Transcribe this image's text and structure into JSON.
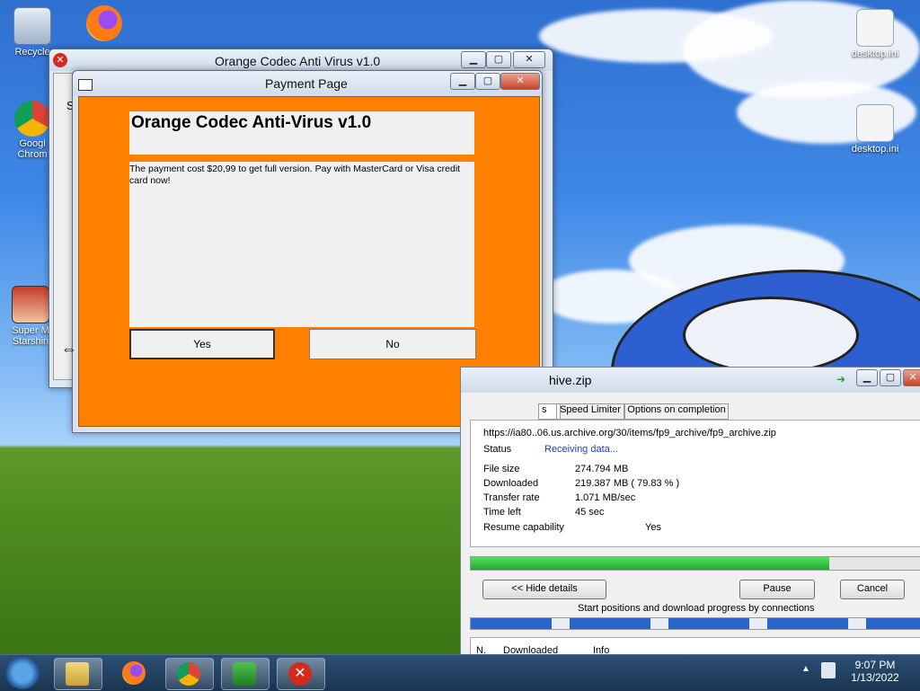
{
  "desktop": {
    "icons_left": [
      {
        "label": "Recycle"
      },
      {
        "label": "Googl Chrom"
      },
      {
        "label": "Super M Starshin"
      }
    ],
    "icons_right": [
      {
        "label": "desktop.ini"
      },
      {
        "label": "desktop.ini"
      }
    ]
  },
  "background_window": {
    "title": "Orange Codec Anti Virus v1.0",
    "left_text": "S"
  },
  "payment_window": {
    "title": "Payment Page",
    "heading": "Orange Codec Anti-Virus v1.0",
    "message": "The payment cost $20,99 to get full version. Pay with MasterCard or Visa credit card now!",
    "yes_label": "Yes",
    "no_label": "No"
  },
  "download_window": {
    "title_partial": "hive.zip",
    "tabs": [
      "s",
      "Speed Limiter",
      "Options on completion"
    ],
    "url": "https://ia80..06.us.archive.org/30/items/fp9_archive/fp9_archive.zip",
    "status_label": "Status",
    "status_value": "Receiving data...",
    "rows": [
      {
        "label": "File size",
        "value": "274.794  MB"
      },
      {
        "label": "Downloaded",
        "value": "219.387  MB  ( 79.83 % )"
      },
      {
        "label": "Transfer rate",
        "value": "1.071  MB/sec"
      },
      {
        "label": "Time left",
        "value": "45 sec"
      },
      {
        "label": "Resume capability",
        "value": "Yes"
      }
    ],
    "progress": 0.7983,
    "hide_details_label": "<< Hide details",
    "pause_label": "Pause",
    "cancel_label": "Cancel",
    "connections_caption": "Start positions and download progress by connections",
    "table_headers": [
      "N.",
      "Downloaded",
      "Info"
    ]
  },
  "taskbar": {
    "time": "9:07 PM",
    "date": "1/13/2022"
  },
  "colors": {
    "payment_orange": "#ff8000",
    "progress_green": "#2fbf3a",
    "status_blue": "#1a3fbf"
  }
}
